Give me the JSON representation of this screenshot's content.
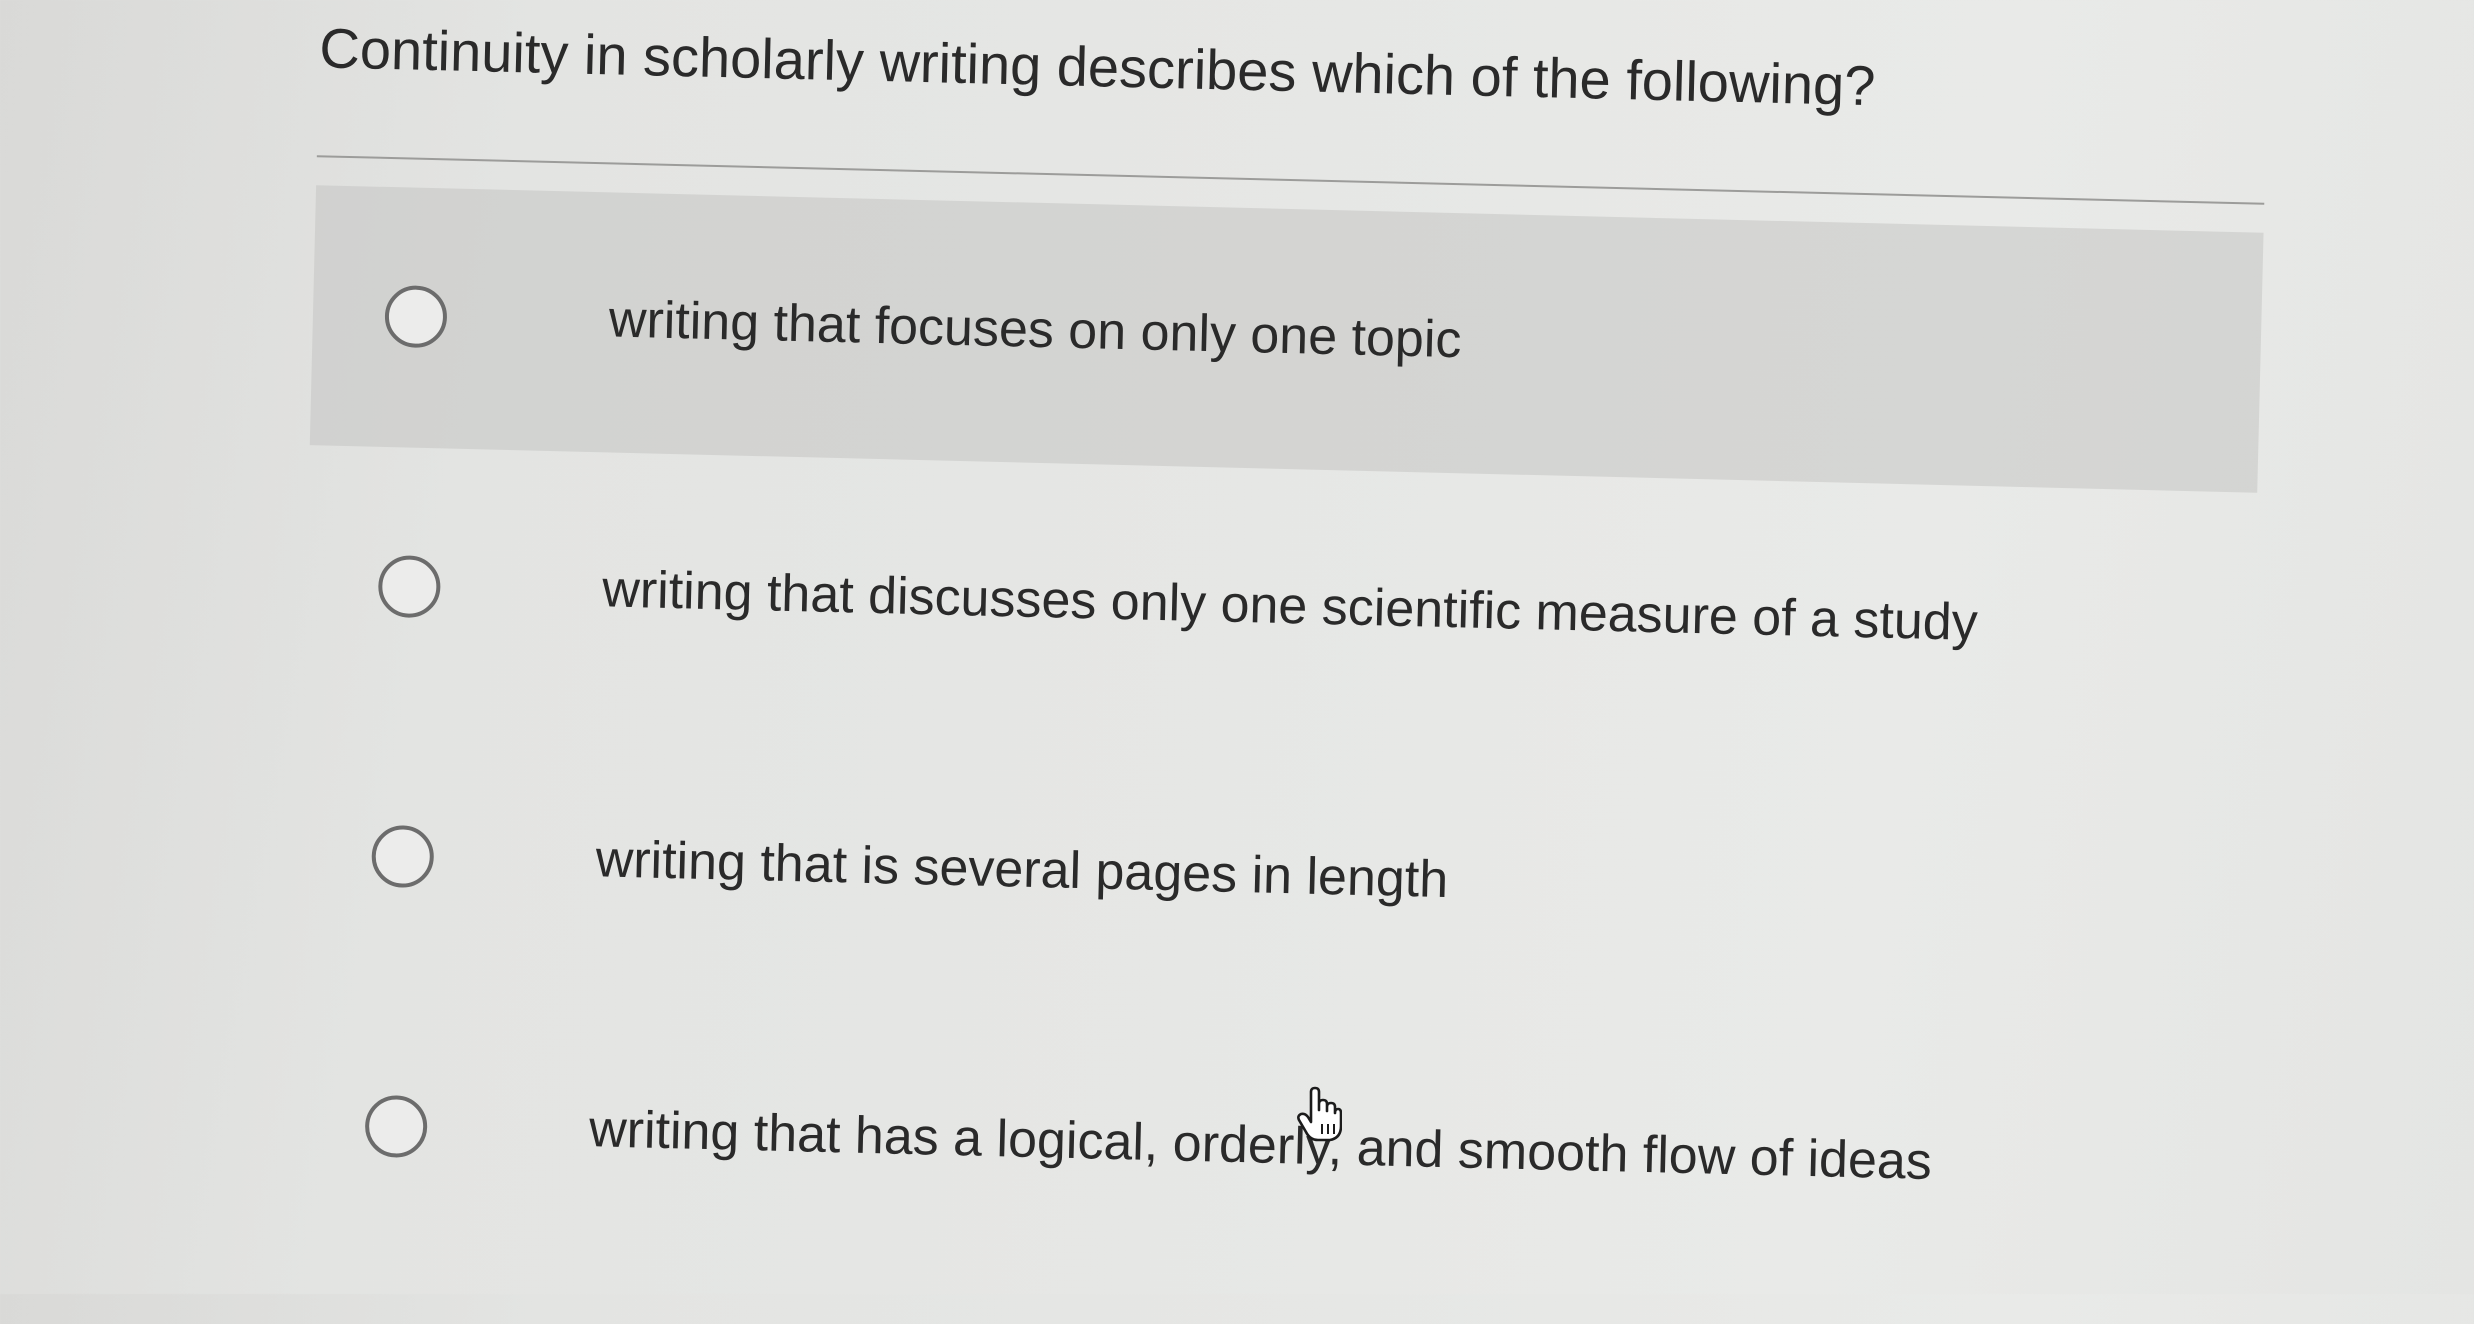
{
  "question": {
    "text": "Continuity in scholarly writing describes which of the following?"
  },
  "options": [
    {
      "label": "writing that focuses on only one topic",
      "selected": false
    },
    {
      "label": "writing that discusses only one scientific measure of a study",
      "selected": false
    },
    {
      "label": "writing that is several pages in length",
      "selected": false
    },
    {
      "label": "writing that has a logical, orderly, and smooth flow of ideas",
      "selected": false
    }
  ],
  "cursor": {
    "icon": "hand-pointer-icon"
  }
}
